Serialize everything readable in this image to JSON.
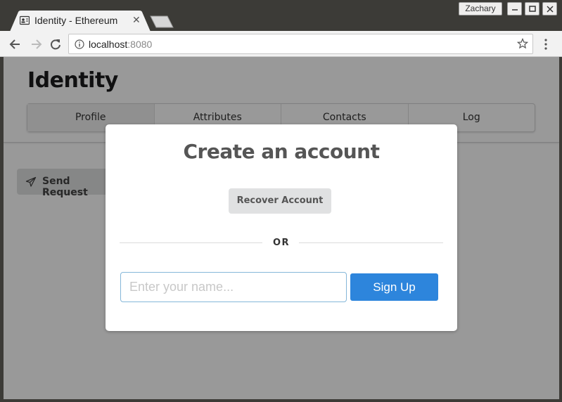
{
  "window": {
    "user": "Zachary",
    "controls": [
      "minimize",
      "maximize",
      "close"
    ]
  },
  "tab": {
    "title": "Identity - Ethereum",
    "icon": "contact-card-icon"
  },
  "omnibox": {
    "host": "localhost",
    "port": ":8080"
  },
  "app": {
    "title": "Identity",
    "menu": [
      "Profile",
      "Attributes",
      "Contacts",
      "Log"
    ],
    "active_menu": "Profile",
    "send_request_label": "Send Request"
  },
  "modal": {
    "title": "Create an account",
    "recover_label": "Recover Account",
    "divider_text": "OR",
    "name_placeholder": "Enter your name...",
    "signup_label": "Sign Up"
  },
  "colors": {
    "primary": "#2d85dc",
    "input_focus_border": "#85b7d9"
  }
}
